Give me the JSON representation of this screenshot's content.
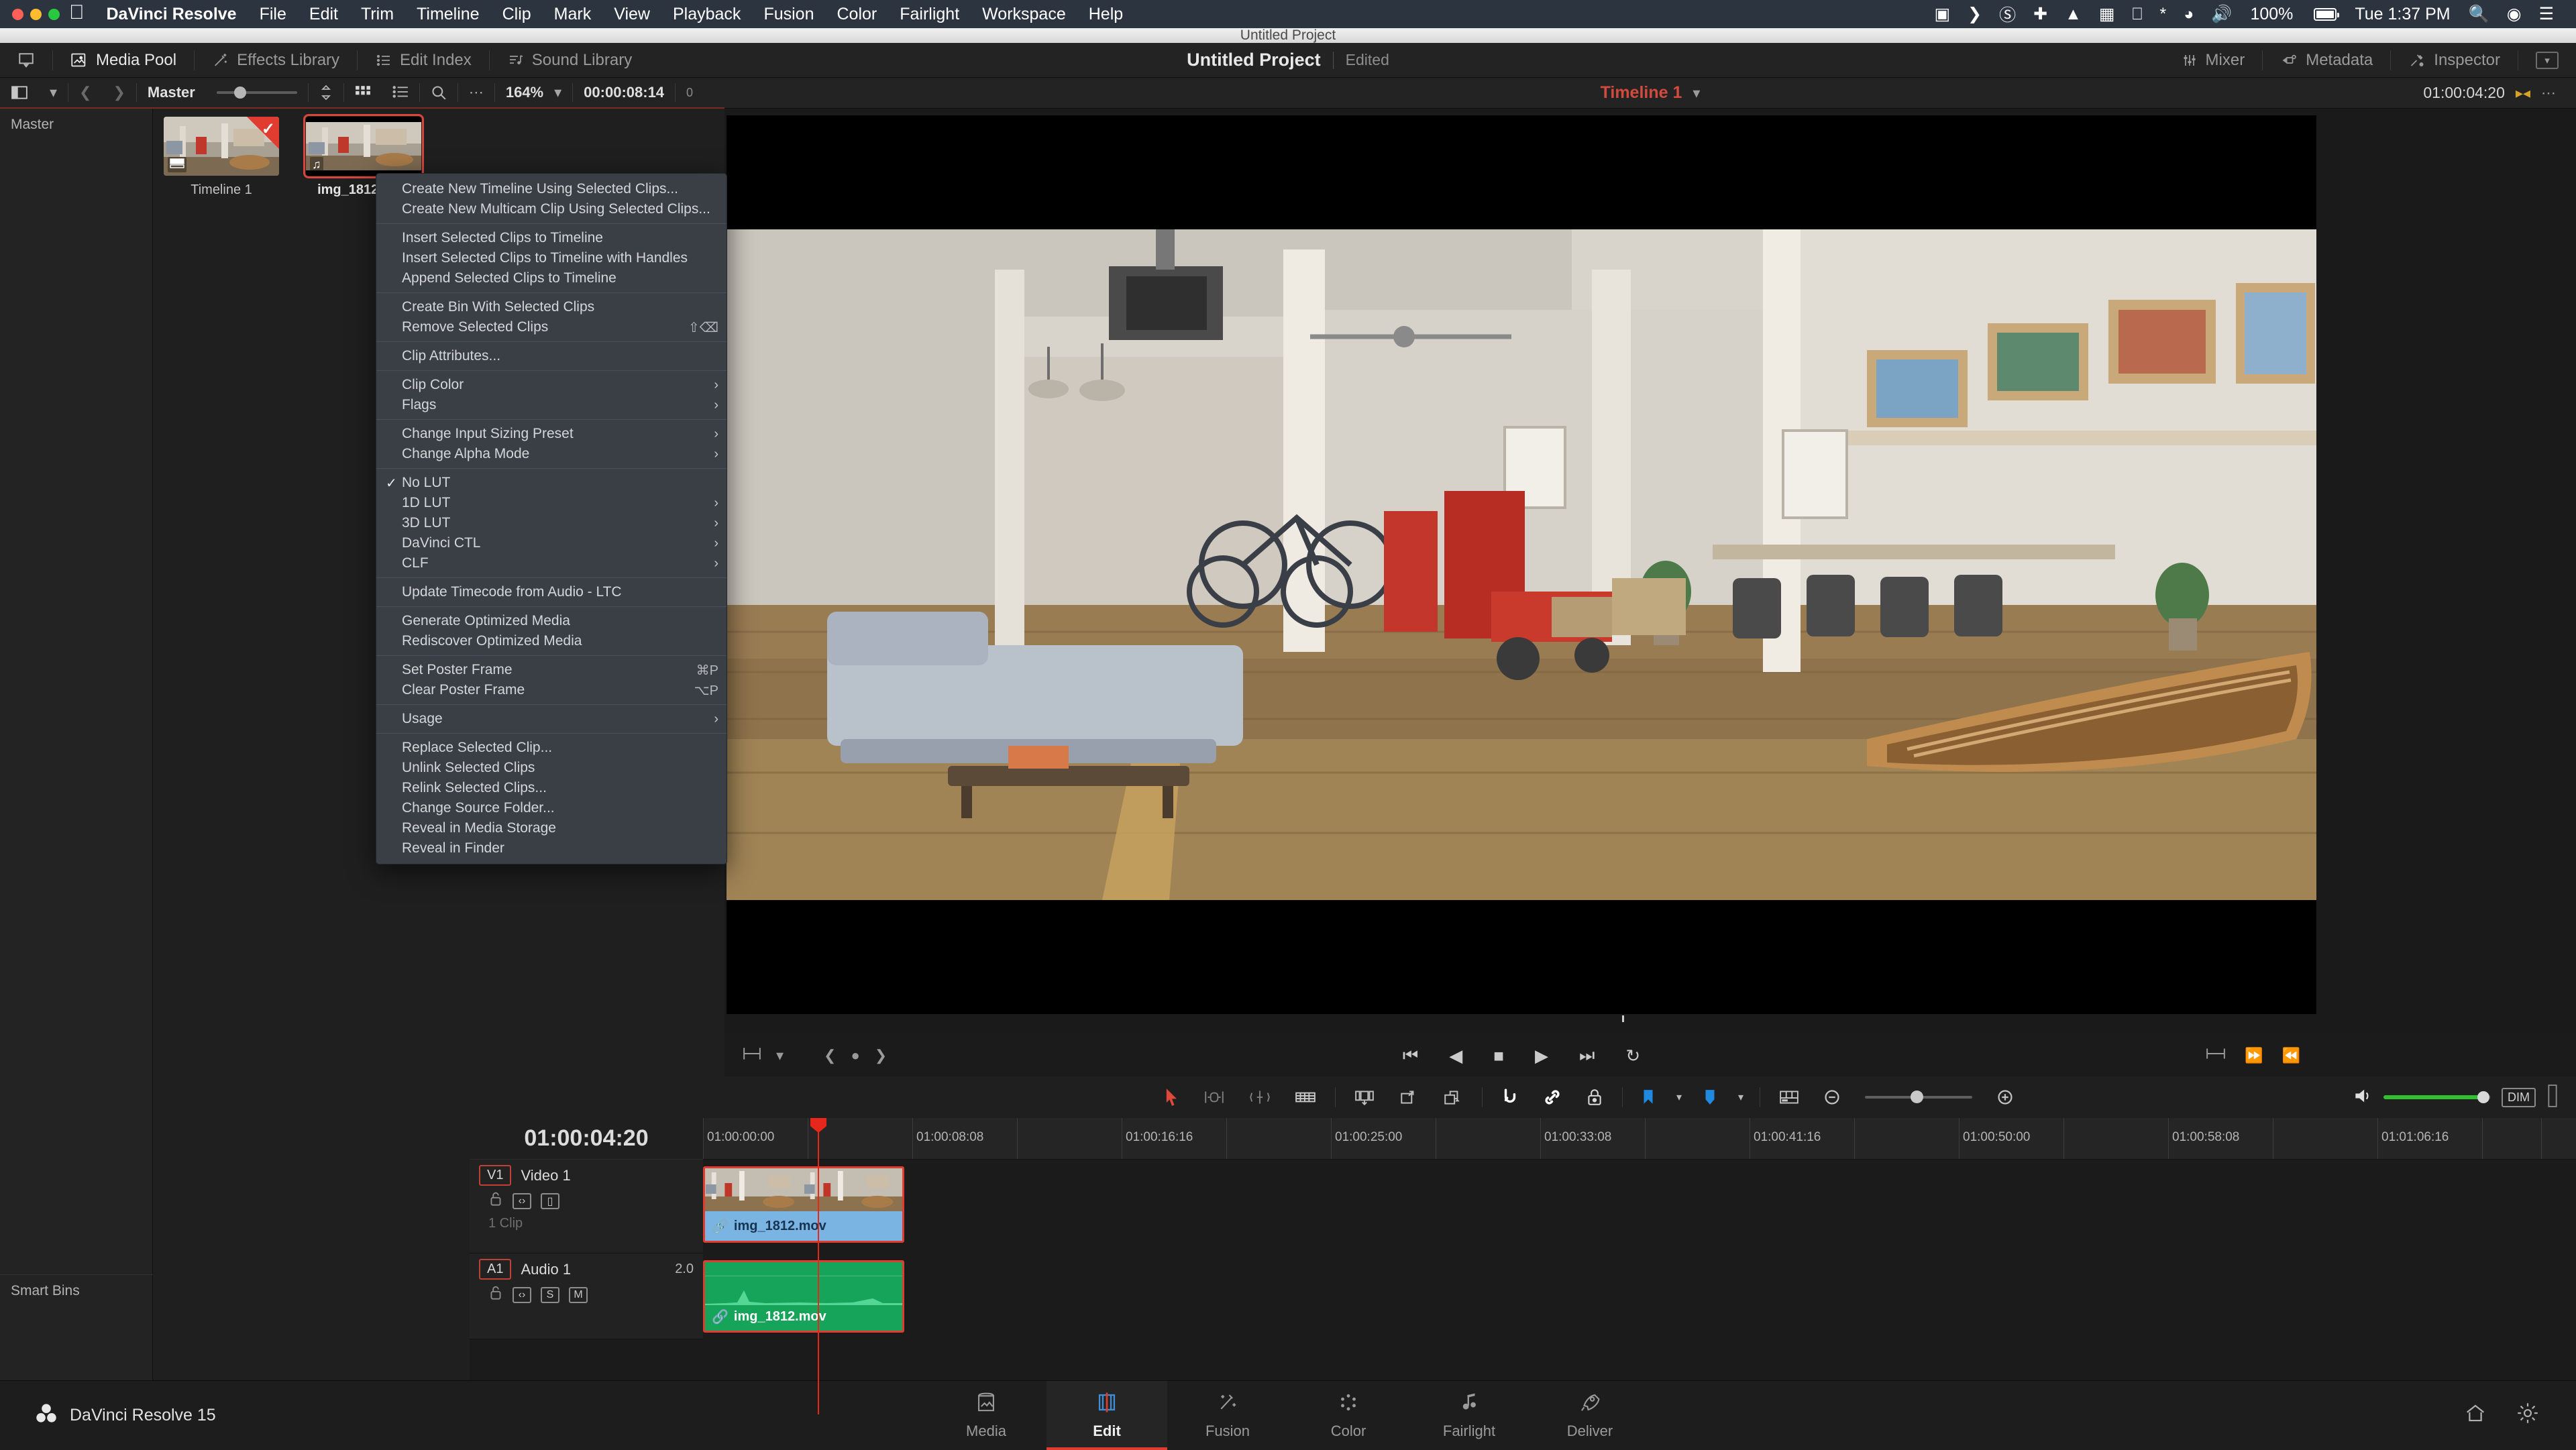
{
  "macbar": {
    "apple": "apple-logo",
    "items": [
      "DaVinci Resolve",
      "File",
      "Edit",
      "Trim",
      "Timeline",
      "Clip",
      "Mark",
      "View",
      "Playback",
      "Fusion",
      "Color",
      "Fairlight",
      "Workspace",
      "Help"
    ],
    "battery_percent": "100%",
    "clock": "Tue 1:37 PM",
    "right_icons": [
      "sidecar-icon",
      "chevron-right-icon",
      "creative-cloud-icon",
      "dropbox-icon",
      "cloud-upload-icon",
      "grid-icon",
      "airplay-icon",
      "bluetooth-icon",
      "wifi-icon",
      "volume-icon",
      "battery-icon",
      "search-icon",
      "siri-icon",
      "control-center-icon"
    ]
  },
  "window": {
    "title": "Untitled Project"
  },
  "topbar": {
    "left_buttons": [
      {
        "label": "Media Pool",
        "icon": "media-pool-icon",
        "active": true
      },
      {
        "label": "Effects Library",
        "icon": "effects-library-icon",
        "active": false
      },
      {
        "label": "Edit Index",
        "icon": "edit-index-icon",
        "active": false
      },
      {
        "label": "Sound Library",
        "icon": "sound-library-icon",
        "active": false
      }
    ],
    "project_name": "Untitled Project",
    "project_status": "Edited",
    "right_buttons": [
      {
        "label": "Mixer",
        "icon": "mixer-icon"
      },
      {
        "label": "Metadata",
        "icon": "metadata-icon"
      },
      {
        "label": "Inspector",
        "icon": "inspector-icon"
      }
    ]
  },
  "poolbar": {
    "bin_label": "Master",
    "zoom_percent": "164%",
    "duration": "00:00:08:14",
    "count": "0",
    "icons": [
      "panel-toggle-icon",
      "chevron-down-icon",
      "back-arrow-icon",
      "forward-arrow-icon",
      "sort-icon",
      "thumbnail-view-icon",
      "list-view-icon",
      "search-icon",
      "more-options-icon"
    ]
  },
  "viewer": {
    "timeline_name": "Timeline 1",
    "timecode": "01:00:04:20",
    "transport_icons": [
      "jump-to-start-icon",
      "play-reverse-icon",
      "stop-icon",
      "play-icon",
      "jump-to-end-icon",
      "loop-icon"
    ],
    "left_icons": [
      "viewer-options-icon",
      "chevron-down-icon",
      "prev-marker-icon",
      "marker-dot-icon",
      "next-marker-icon"
    ],
    "right_icons": [
      "in-out-icon",
      "mark-in-icon",
      "mark-out-icon"
    ]
  },
  "mediapool": {
    "bins": [
      "Master"
    ],
    "smart_bins_label": "Smart Bins",
    "clips": [
      {
        "name": "Timeline 1",
        "type": "timeline",
        "selected": false,
        "badge": "timeline-badge-icon",
        "flagged": true
      },
      {
        "name": "img_1812.mov",
        "type": "video",
        "selected": true,
        "badge": "audio-note-icon",
        "flagged": false
      }
    ]
  },
  "context_menu": {
    "groups": [
      [
        {
          "label": "Create New Timeline Using Selected Clips...",
          "shortcut": "",
          "submenu": false,
          "checked": false
        },
        {
          "label": "Create New Multicam Clip Using Selected Clips...",
          "shortcut": "",
          "submenu": false,
          "checked": false
        }
      ],
      [
        {
          "label": "Insert Selected Clips to Timeline",
          "shortcut": "",
          "submenu": false,
          "checked": false
        },
        {
          "label": "Insert Selected Clips to Timeline with Handles",
          "shortcut": "",
          "submenu": false,
          "checked": false
        },
        {
          "label": "Append Selected Clips to Timeline",
          "shortcut": "",
          "submenu": false,
          "checked": false
        }
      ],
      [
        {
          "label": "Create Bin With Selected Clips",
          "shortcut": "",
          "submenu": false,
          "checked": false
        },
        {
          "label": "Remove Selected Clips",
          "shortcut": "⇧⌫",
          "submenu": false,
          "checked": false
        }
      ],
      [
        {
          "label": "Clip Attributes...",
          "shortcut": "",
          "submenu": false,
          "checked": false
        }
      ],
      [
        {
          "label": "Clip Color",
          "shortcut": "",
          "submenu": true,
          "checked": false
        },
        {
          "label": "Flags",
          "shortcut": "",
          "submenu": true,
          "checked": false
        }
      ],
      [
        {
          "label": "Change Input Sizing Preset",
          "shortcut": "",
          "submenu": true,
          "checked": false
        },
        {
          "label": "Change Alpha Mode",
          "shortcut": "",
          "submenu": true,
          "checked": false
        }
      ],
      [
        {
          "label": "No LUT",
          "shortcut": "",
          "submenu": false,
          "checked": true
        },
        {
          "label": "1D LUT",
          "shortcut": "",
          "submenu": true,
          "checked": false
        },
        {
          "label": "3D LUT",
          "shortcut": "",
          "submenu": true,
          "checked": false
        },
        {
          "label": "DaVinci CTL",
          "shortcut": "",
          "submenu": true,
          "checked": false
        },
        {
          "label": "CLF",
          "shortcut": "",
          "submenu": true,
          "checked": false
        }
      ],
      [
        {
          "label": "Update Timecode from Audio - LTC",
          "shortcut": "",
          "submenu": false,
          "checked": false
        }
      ],
      [
        {
          "label": "Generate Optimized Media",
          "shortcut": "",
          "submenu": false,
          "checked": false
        },
        {
          "label": "Rediscover Optimized Media",
          "shortcut": "",
          "submenu": false,
          "checked": false
        }
      ],
      [
        {
          "label": "Set Poster Frame",
          "shortcut": "⌘P",
          "submenu": false,
          "checked": false
        },
        {
          "label": "Clear Poster Frame",
          "shortcut": "⌥P",
          "submenu": false,
          "checked": false
        }
      ],
      [
        {
          "label": "Usage",
          "shortcut": "",
          "submenu": true,
          "checked": false
        }
      ],
      [
        {
          "label": "Replace Selected Clip...",
          "shortcut": "",
          "submenu": false,
          "checked": false
        },
        {
          "label": "Unlink Selected Clips",
          "shortcut": "",
          "submenu": false,
          "checked": false
        },
        {
          "label": "Relink Selected Clips...",
          "shortcut": "",
          "submenu": false,
          "checked": false
        },
        {
          "label": "Change Source Folder...",
          "shortcut": "",
          "submenu": false,
          "checked": false
        },
        {
          "label": "Reveal in Media Storage",
          "shortcut": "",
          "submenu": false,
          "checked": false
        },
        {
          "label": "Reveal in Finder",
          "shortcut": "",
          "submenu": false,
          "checked": false
        }
      ]
    ]
  },
  "timeline_toolbar": {
    "tools": [
      "selection-mode-icon",
      "trim-mode-icon",
      "dynamic-trim-icon",
      "razor-icon",
      "insert-clip-icon",
      "overwrite-clip-icon",
      "place-on-top-icon",
      "snapping-icon",
      "link-clips-icon",
      "flag-lock-icon",
      "marker-icon",
      "flag-icon",
      "timeline-view-options-icon",
      "zoom-out-icon",
      "zoom-in-icon",
      "audio-volume-icon",
      "dim-button"
    ],
    "dim_label": "DIM"
  },
  "timeline": {
    "timecode": "01:00:04:20",
    "ruler_labels": [
      "01:00:00:00",
      "01:00:08:08",
      "01:00:16:16",
      "01:00:25:00",
      "01:00:33:08",
      "01:00:41:16",
      "01:00:50:00",
      "01:00:58:08",
      "01:01:06:16"
    ],
    "tracks": [
      {
        "badge": "V1",
        "name": "Video 1",
        "channels": "",
        "clip_count": "1 Clip",
        "controls": [
          "lock-icon",
          "auto-select-icon",
          "video-enable-icon"
        ],
        "clip": {
          "name": "img_1812.mov",
          "link_icon": "link-icon"
        }
      },
      {
        "badge": "A1",
        "name": "Audio 1",
        "channels": "2.0",
        "clip_count": "",
        "controls": [
          "lock-icon",
          "auto-select-icon",
          "solo-icon",
          "mute-icon"
        ],
        "clip": {
          "name": "img_1812.mov",
          "link_icon": "link-icon"
        }
      }
    ],
    "track_control_labels": {
      "solo": "S",
      "mute": "M"
    }
  },
  "dock": {
    "app_name": "DaVinci Resolve 15",
    "pages": [
      {
        "label": "Media",
        "icon": "media-page-icon",
        "active": false
      },
      {
        "label": "Edit",
        "icon": "edit-page-icon",
        "active": true
      },
      {
        "label": "Fusion",
        "icon": "fusion-page-icon",
        "active": false
      },
      {
        "label": "Color",
        "icon": "color-page-icon",
        "active": false
      },
      {
        "label": "Fairlight",
        "icon": "fairlight-page-icon",
        "active": false
      },
      {
        "label": "Deliver",
        "icon": "deliver-page-icon",
        "active": false
      }
    ],
    "right_icons": [
      "home-icon",
      "settings-gear-icon"
    ]
  }
}
